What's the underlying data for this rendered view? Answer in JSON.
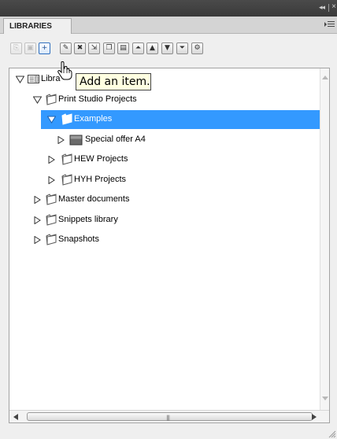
{
  "panel": {
    "tab_label": "LIBRARIES",
    "tooltip": "Add an item."
  },
  "toolbar": {
    "buttons": [
      {
        "name": "open-icon",
        "glyph": "⎘",
        "state": "disabled"
      },
      {
        "name": "save-icon",
        "glyph": "▣",
        "state": "disabled"
      },
      {
        "name": "add-item-icon",
        "glyph": "+",
        "state": "active"
      },
      {
        "name": "edit-icon",
        "glyph": "✎",
        "state": "normal"
      },
      {
        "name": "delete-icon",
        "glyph": "✖",
        "state": "normal"
      },
      {
        "name": "import-icon",
        "glyph": "⇲",
        "state": "normal"
      },
      {
        "name": "copy-icon",
        "glyph": "❐",
        "state": "normal"
      },
      {
        "name": "paste-icon",
        "glyph": "▤",
        "state": "normal"
      },
      {
        "name": "move-top-icon",
        "glyph": "⏶",
        "state": "normal"
      },
      {
        "name": "move-up-icon",
        "glyph": "▲",
        "state": "normal"
      },
      {
        "name": "move-down-icon",
        "glyph": "▼",
        "state": "normal"
      },
      {
        "name": "move-bottom-icon",
        "glyph": "⏷",
        "state": "normal"
      },
      {
        "name": "properties-icon",
        "glyph": "⚙",
        "state": "normal"
      }
    ]
  },
  "tree": {
    "items": [
      {
        "label": "Libra",
        "level": 0,
        "expanded": true,
        "icon": "library",
        "selected": false
      },
      {
        "label": "Print Studio Projects",
        "level": 1,
        "expanded": true,
        "icon": "folder",
        "selected": false
      },
      {
        "label": "Examples",
        "level": 2,
        "expanded": true,
        "icon": "folder",
        "selected": true
      },
      {
        "label": "Special offer A4",
        "level": 3,
        "expanded": false,
        "icon": "document",
        "selected": false
      },
      {
        "label": "HEW Projects",
        "level": 2,
        "expanded": false,
        "icon": "folder",
        "selected": false
      },
      {
        "label": "HYH Projects",
        "level": 2,
        "expanded": false,
        "icon": "folder",
        "selected": false
      },
      {
        "label": "Master documents",
        "level": 1,
        "expanded": false,
        "icon": "folder",
        "selected": false
      },
      {
        "label": "Snippets library",
        "level": 1,
        "expanded": false,
        "icon": "folder",
        "selected": false
      },
      {
        "label": "Snapshots",
        "level": 1,
        "expanded": false,
        "icon": "folder",
        "selected": false
      }
    ]
  },
  "colors": {
    "selection": "#3399ff",
    "tooltip_bg": "#ffffe1",
    "title_bar": "#3f3f3f"
  }
}
